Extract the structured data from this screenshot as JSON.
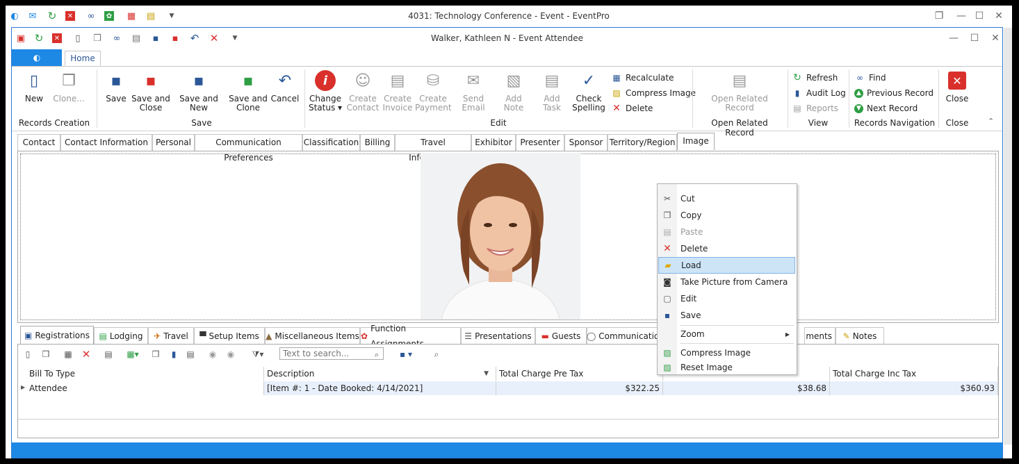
{
  "outer_window": {
    "title": "4031: Technology Conference - Event - EventPro",
    "quick_access_icons": [
      "eventpro-logo-icon",
      "mail-icon",
      "refresh-icon",
      "close-red-icon",
      "binoculars-icon",
      "gear-green-icon",
      "calendar-icon",
      "clipboard-icon",
      "dropdown-arrow-icon"
    ],
    "controls": {
      "restore": "❐",
      "minimize": "—",
      "maximize": "☐",
      "close": "✕"
    }
  },
  "inner_window": {
    "title": "Walker, Kathleen N - Event Attendee",
    "controls": {
      "minimize": "—",
      "maximize": "☐",
      "close": "✕"
    }
  },
  "ribbon_tabs": {
    "home": "Home"
  },
  "ribbon": {
    "records_creation": {
      "label": "Records Creation",
      "new": "New",
      "clone": "Clone..."
    },
    "save": {
      "label": "Save",
      "save": "Save",
      "save_close_1": "Save and",
      "save_close_2": "Close",
      "save_new": "Save and New",
      "save_clone_1": "Save and",
      "save_clone_2": "Clone",
      "cancel": "Cancel"
    },
    "edit": {
      "label": "Edit",
      "change_status_1": "Change",
      "change_status_2": "Status ▾",
      "create_contact_1": "Create",
      "create_contact_2": "Contact",
      "create_invoice_1": "Create",
      "create_invoice_2": "Invoice",
      "create_payment_1": "Create",
      "create_payment_2": "Payment",
      "send_email": "Send Email",
      "add_note": "Add Note",
      "add_task": "Add Task",
      "check_spelling_1": "Check",
      "check_spelling_2": "Spelling",
      "recalculate": "Recalculate",
      "compress_image": "Compress Image",
      "delete": "Delete"
    },
    "open_related": {
      "label": "Open Related Record",
      "button_1": "Open Related",
      "button_2": "Record"
    },
    "view": {
      "label": "View",
      "refresh": "Refresh",
      "audit_log": "Audit Log",
      "reports": "Reports"
    },
    "records_navigation": {
      "label": "Records Navigation",
      "find": "Find",
      "previous": "Previous Record",
      "next": "Next Record"
    },
    "close": {
      "label": "Close",
      "button": "Close"
    }
  },
  "record_tabs": [
    "Contact",
    "Contact Information",
    "Personal",
    "Communication Preferences",
    "Classification",
    "Billing",
    "Travel Information",
    "Exhibitor",
    "Presenter",
    "Sponsor",
    "Territory/Region",
    "Image"
  ],
  "bottom_tabs": [
    "Registrations",
    "Lodging",
    "Travel",
    "Setup Items",
    "Miscellaneous Items",
    "Function Assignments",
    "Presentations",
    "Guests",
    "Communications",
    "ments",
    "Notes"
  ],
  "grid": {
    "search_placeholder": "Text to search...",
    "columns": [
      "Bill To Type",
      "Description",
      "Total Charge Pre Tax",
      "",
      "Total Charge Inc Tax"
    ],
    "rows": [
      {
        "bill_to_type": "Attendee",
        "description": "[Item #: 1 - Date Booked: 4/14/2021]",
        "pre_tax": "$322.25",
        "tax": "$38.68",
        "inc_tax": "$360.93"
      }
    ]
  },
  "context_menu": {
    "items": [
      {
        "label": "Cut",
        "icon": "scissors-icon"
      },
      {
        "label": "Copy",
        "icon": "copy-icon"
      },
      {
        "label": "Paste",
        "icon": "paste-icon"
      },
      {
        "label": "Delete",
        "icon": "delete-x-icon"
      },
      {
        "label": "Load",
        "icon": "folder-icon"
      },
      {
        "label": "Take Picture from Camera",
        "icon": "camera-icon"
      },
      {
        "label": "Edit",
        "icon": "edit-frame-icon"
      },
      {
        "label": "Save",
        "icon": "floppy-icon"
      },
      {
        "label": "Zoom",
        "icon": ""
      },
      {
        "label": "Compress Image",
        "icon": "image-icon"
      },
      {
        "label": "Reset Image",
        "icon": "image-icon"
      }
    ],
    "submenu_arrow": "▶"
  },
  "colors": {
    "accent": "#1e88e5",
    "menu_highlight": "#cde4f7",
    "red": "#d9302c",
    "green": "#2e9e44"
  }
}
